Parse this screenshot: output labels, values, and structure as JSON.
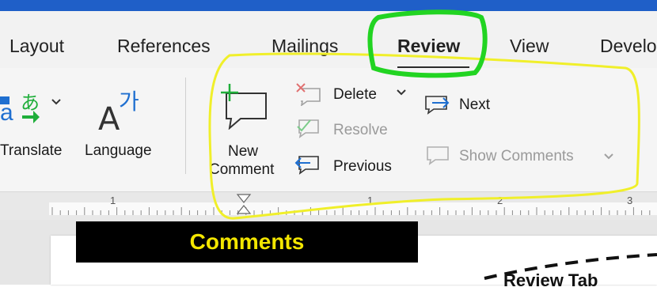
{
  "tabs": [
    {
      "label": "Layout"
    },
    {
      "label": "References"
    },
    {
      "label": "Mailings"
    },
    {
      "label": "Review",
      "active": true
    },
    {
      "label": "View"
    },
    {
      "label": "Develo"
    }
  ],
  "ribbon": {
    "translate_label": "Translate",
    "language_label": "Language",
    "new_comment_line1": "New",
    "new_comment_line2": "Comment",
    "delete_label": "Delete",
    "resolve_label": "Resolve",
    "previous_label": "Previous",
    "next_label": "Next",
    "show_comments_label": "Show Comments"
  },
  "ruler": {
    "marks": [
      "1",
      "1",
      "2",
      "3"
    ]
  },
  "callout": {
    "text": "Comments"
  },
  "document": {
    "partial_heading": "Review Tab"
  },
  "colors": {
    "title_bar": "#1f5fc8",
    "callout_text": "#f3e600",
    "highlight_yellow": "#f0ef2a",
    "highlight_green": "#22d422",
    "icon_blue": "#1f6fd0",
    "icon_green": "#1fae3a"
  },
  "icons": [
    "translate-icon",
    "language-icon",
    "new-comment-icon",
    "delete-comment-icon",
    "resolve-comment-icon",
    "previous-comment-icon",
    "next-comment-icon",
    "show-comments-icon"
  ]
}
